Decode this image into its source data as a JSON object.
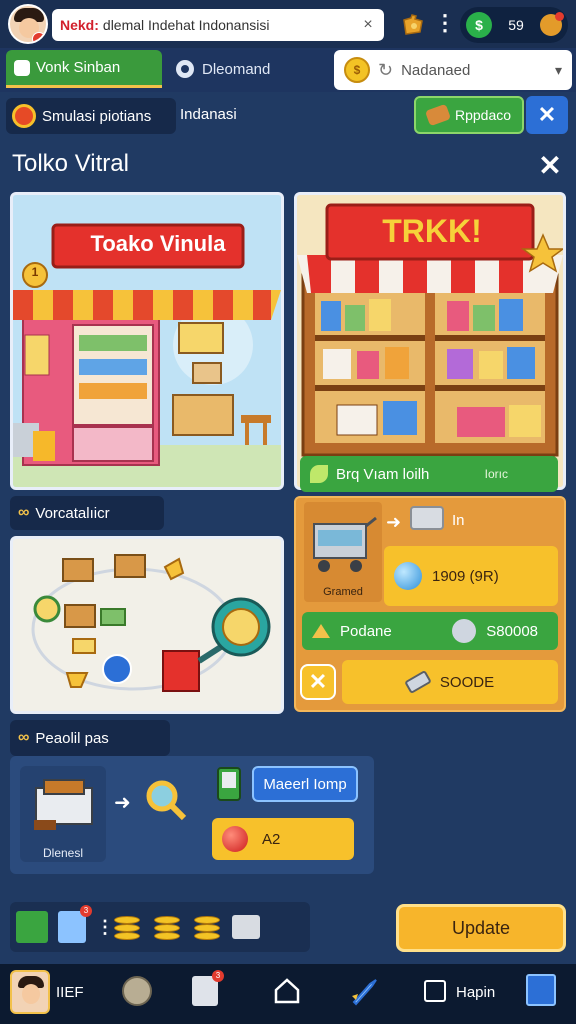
{
  "topbar": {
    "url_brand": "Nekd:",
    "url_text": "dlemal Indehat Indonansisi",
    "url_clear": "×",
    "menu_dots": "⋮",
    "coins_icon": "$",
    "coins_value": "59"
  },
  "tabs": {
    "active_label": "Vonk Sinban",
    "second_label": "Dleomand",
    "select_value": "Nadanaed",
    "select_coin": "$"
  },
  "sim": {
    "label": "Smulasi piotians",
    "suffix": "Indanasi",
    "approve_label": "Rppdaco",
    "close_symbol": "✕"
  },
  "panel": {
    "title": "Tolko Vitral",
    "close_symbol": "✕"
  },
  "cards": {
    "left_sign": "Toako Vinula",
    "left_badge": "1",
    "right_sign": "TRKK!",
    "green_bar_label": "Brq Vıam loilh",
    "green_bar_suffix": "Iorıc"
  },
  "visualization": {
    "tab_icon": "∞",
    "tab_label": "Vorcatalıicr"
  },
  "orange_panel": {
    "scanner_label": "Gramed",
    "arrow": "➜",
    "in_label": "In",
    "price_text": "1909 (9R)",
    "produce_label": "Podane",
    "produce_code": "S80008",
    "x_symbol": "✕",
    "code_label": "SOODE"
  },
  "production": {
    "tab_icon": "∞",
    "tab_label": "Peaolil pas",
    "machine_label": "Dlenesl",
    "arrow": "➜",
    "maser_label": "Maeerl Iomp",
    "a2_label": "A2"
  },
  "inventory": {
    "dots": "⋮"
  },
  "upgrade_label": "Update",
  "bottom_nav": {
    "label_1": "IIEF",
    "label_2": "Hapin"
  },
  "colors": {
    "background": "#203a63",
    "green": "#3aa540",
    "yellow": "#f7c12b",
    "orange": "#e49a3c",
    "blue": "#2c6fd6"
  }
}
